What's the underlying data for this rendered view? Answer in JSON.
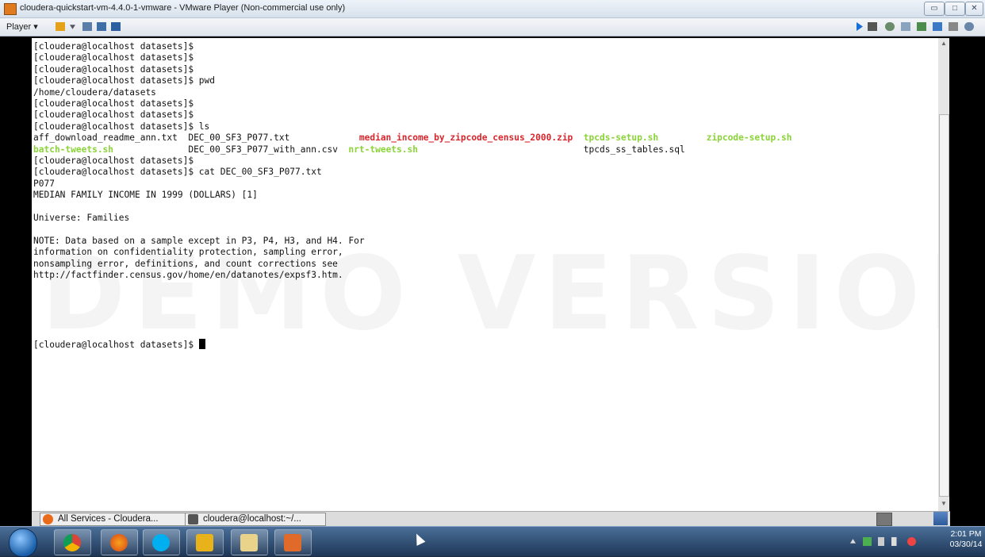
{
  "window": {
    "title": "cloudera-quickstart-vm-4.4.0-1-vmware - VMware Player (Non-commercial use only)",
    "min_label": "▭",
    "max_label": "□",
    "close_label": "✕"
  },
  "toolbar": {
    "player_label": "Player ▾"
  },
  "terminal": {
    "lines_top": [
      "[cloudera@localhost datasets]$",
      "[cloudera@localhost datasets]$",
      "[cloudera@localhost datasets]$",
      "[cloudera@localhost datasets]$ pwd",
      "/home/cloudera/datasets",
      "[cloudera@localhost datasets]$",
      "[cloudera@localhost datasets]$",
      "[cloudera@localhost datasets]$ ls"
    ],
    "ls_row1": [
      {
        "text": "aff_download_readme_ann.txt  ",
        "color": ""
      },
      {
        "text": "DEC_00_SF3_P077.txt             ",
        "color": ""
      },
      {
        "text": "median_income_by_zipcode_census_2000.zip",
        "color": "red"
      },
      {
        "text": "  ",
        "color": ""
      },
      {
        "text": "tpcds-setup.sh",
        "color": "green"
      },
      {
        "text": "         ",
        "color": ""
      },
      {
        "text": "zipcode-setup.sh",
        "color": "green"
      }
    ],
    "ls_row2": [
      {
        "text": "batch-tweets.sh",
        "color": "green"
      },
      {
        "text": "              DEC_00_SF3_P077_with_ann.csv  ",
        "color": ""
      },
      {
        "text": "nrt-tweets.sh",
        "color": "green"
      },
      {
        "text": "                               tpcds_ss_tables.sql",
        "color": ""
      }
    ],
    "lines_bottom": [
      "[cloudera@localhost datasets]$",
      "[cloudera@localhost datasets]$ cat DEC_00_SF3_P077.txt",
      "P077",
      "MEDIAN FAMILY INCOME IN 1999 (DOLLARS) [1]",
      "",
      "Universe: Families",
      "",
      "NOTE: Data based on a sample except in P3, P4, H3, and H4. For",
      "information on confidentiality protection, sampling error,",
      "nonsampling error, definitions, and count corrections see",
      "http://factfinder.census.gov/home/en/datanotes/expsf3.htm.",
      "",
      "",
      "",
      "",
      ""
    ],
    "prompt": "[cloudera@localhost datasets]$ ",
    "watermark": "DEMO VERSION"
  },
  "guest_taskbar": {
    "items": [
      {
        "label": "All Services - Cloudera..."
      },
      {
        "label": "cloudera@localhost:~/..."
      }
    ]
  },
  "taskbar": {
    "time": "2:01 PM",
    "date": "03/30/14"
  },
  "icons": {
    "start": "windows-start-icon",
    "chrome": "chrome-icon",
    "firefox": "firefox-icon",
    "skype": "skype-icon",
    "vmware": "vmware-icon",
    "explorer": "file-explorer-icon",
    "app": "app-icon"
  }
}
